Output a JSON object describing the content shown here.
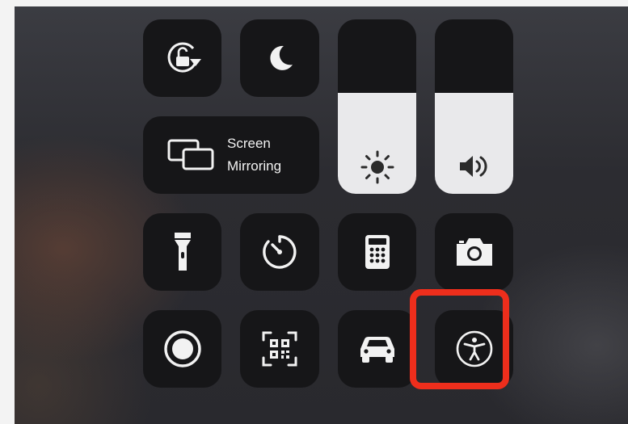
{
  "control_center": {
    "screen_mirroring": {
      "line1": "Screen",
      "line2": "Mirroring"
    },
    "brightness": {
      "level_percent": 58,
      "icon": "sun-icon"
    },
    "volume": {
      "level_percent": 58,
      "icon": "speaker-icon"
    },
    "tiles": [
      {
        "name": "rotation-lock",
        "icon": "lock-rotation-icon"
      },
      {
        "name": "do-not-disturb",
        "icon": "moon-icon"
      },
      {
        "name": "flashlight",
        "icon": "flashlight-icon"
      },
      {
        "name": "timer",
        "icon": "timer-icon"
      },
      {
        "name": "calculator",
        "icon": "calculator-icon"
      },
      {
        "name": "camera",
        "icon": "camera-icon"
      },
      {
        "name": "screen-recording",
        "icon": "record-icon"
      },
      {
        "name": "qr-scanner",
        "icon": "qr-code-icon"
      },
      {
        "name": "driving-mode",
        "icon": "car-icon"
      },
      {
        "name": "accessibility",
        "icon": "accessibility-icon"
      }
    ],
    "highlight_color": "#ee2e1c"
  }
}
